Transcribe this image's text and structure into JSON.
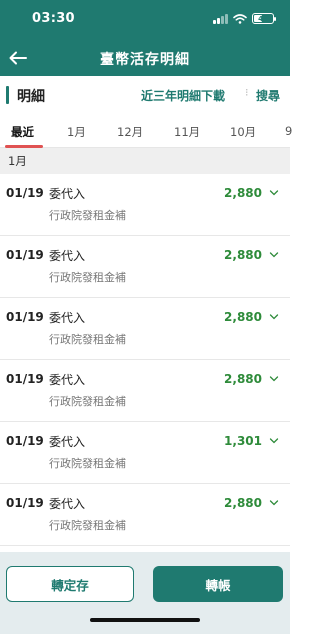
{
  "status_bar": {
    "time": "03:30",
    "battery": "46",
    "icons": [
      "signal-icon",
      "wifi-icon",
      "battery-icon"
    ]
  },
  "nav": {
    "title": "臺幣活存明細",
    "back_icon": "arrow-left-icon"
  },
  "section": {
    "title": "明細",
    "download_link": "近三年明細下載",
    "separator": "⁝",
    "search_link": "搜尋"
  },
  "tabs": [
    "最近",
    "1月",
    "12月",
    "11月",
    "10月",
    "9"
  ],
  "active_tab": "最近",
  "month_header": "1月",
  "transactions": [
    {
      "date": "01/19",
      "desc": "委代入",
      "memo": "行政院發租金補",
      "amount": "2,880"
    },
    {
      "date": "01/19",
      "desc": "委代入",
      "memo": "行政院發租金補",
      "amount": "2,880"
    },
    {
      "date": "01/19",
      "desc": "委代入",
      "memo": "行政院發租金補",
      "amount": "2,880"
    },
    {
      "date": "01/19",
      "desc": "委代入",
      "memo": "行政院發租金補",
      "amount": "2,880"
    },
    {
      "date": "01/19",
      "desc": "委代入",
      "memo": "行政院發租金補",
      "amount": "1,301"
    },
    {
      "date": "01/19",
      "desc": "委代入",
      "memo": "行政院發租金補",
      "amount": "2,880"
    }
  ],
  "buttons": {
    "transfer_deposit": "轉定存",
    "transfer": "轉帳"
  },
  "colors": {
    "brand": "#1f7a70",
    "amount": "#2e8b3a",
    "tab_underline": "#e05252"
  }
}
